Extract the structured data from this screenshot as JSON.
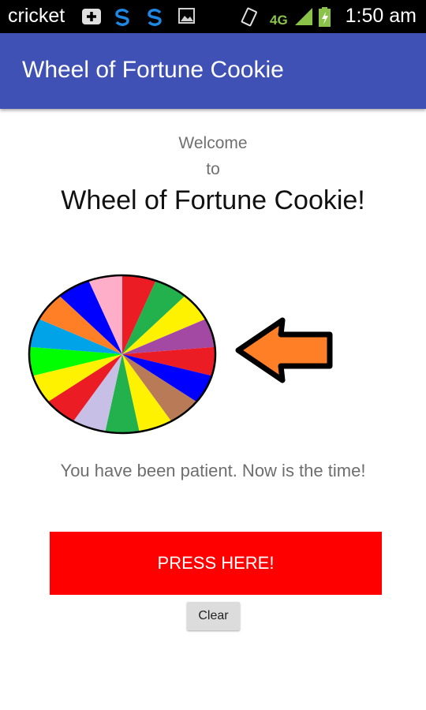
{
  "status_bar": {
    "carrier": "cricket",
    "network": "4G",
    "time": "1:50 am",
    "icons": [
      "plus-badge-icon",
      "sync-icon",
      "sync-icon",
      "image-icon",
      "vibrate-icon",
      "signal-icon",
      "battery-charging-icon"
    ]
  },
  "app_bar": {
    "title": "Wheel of Fortune Cookie",
    "color": "#3f51b5"
  },
  "welcome": {
    "line1": "Welcome",
    "line2": "to",
    "headline": "Wheel of Fortune Cookie!"
  },
  "wheel": {
    "icon": "prize-wheel",
    "segment_colors": [
      "#ec1c24",
      "#22b14c",
      "#fff200",
      "#a349a4",
      "#ec1c24",
      "#0000ff",
      "#b97a57",
      "#fff200",
      "#22b14c",
      "#c8bfe7",
      "#ec1c24",
      "#fff200",
      "#00ff00",
      "#00a2e8",
      "#ff7f27",
      "#0000ff",
      "#ffaec9"
    ]
  },
  "pointer": {
    "icon": "arrow-left-icon",
    "color": "#ff7f27"
  },
  "message": "You have been patient.  Now is the time!",
  "press_button": {
    "label": "PRESS HERE!",
    "color": "#ff0000"
  },
  "clear_button": {
    "label": "Clear"
  }
}
